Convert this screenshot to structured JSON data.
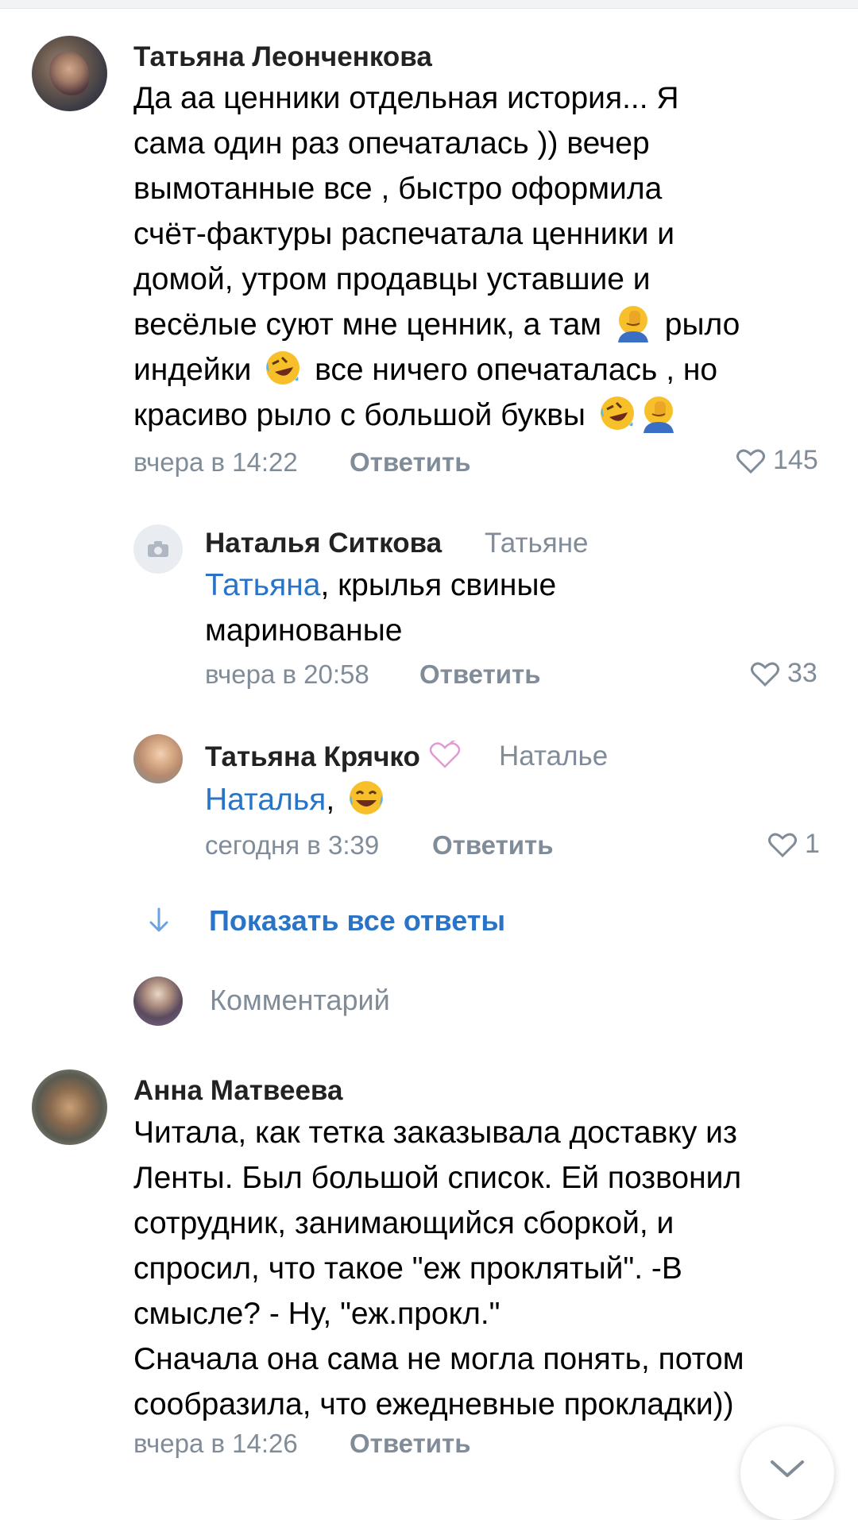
{
  "comments": [
    {
      "author": "Татьяна Леонченкова",
      "text_lines": [
        "Да аа ценники отдельная история... Я",
        "сама один раз опечаталась ))  вечер",
        "вымотанные все , быстро оформила",
        "счёт-фактуры распечатала ценники и",
        "домой, утром продавцы уставшие и"
      ],
      "text_line6a": "весёлые суют мне ценник, а там",
      "text_line6b": "рыло",
      "text_line7a": "индейки",
      "text_line7b": "все ничего опечаталась , но",
      "text_line8": "красиво рыло с большой буквы",
      "time": "вчера в 14:22",
      "reply_label": "Ответить",
      "likes": "145"
    },
    {
      "author": "Анна Матвеева",
      "text_lines": [
        "Читала, как тетка заказывала доставку из",
        "Ленты. Был большой список. Ей позвонил",
        "сотрудник, занимающийся сборкой, и",
        "спросил, что такое \"еж проклятый\". -В",
        "смысле? - Ну, \"еж.прокл.\"",
        "Сначала она сама не могла понять, потом",
        "сообразила, что ежедневные прокладки))"
      ],
      "time": "вчера в 14:26",
      "reply_label": "Ответить"
    }
  ],
  "replies": [
    {
      "author": "Наталья Ситкова",
      "addressee": "Татьяне",
      "mention": "Татьяна",
      "text_rest": ", крылья свиные",
      "text_line2": "маринованые",
      "time": "вчера в 20:58",
      "reply_label": "Ответить",
      "likes": "33"
    },
    {
      "author": "Татьяна Крячко",
      "addressee": "Наталье",
      "mention": "Наталья",
      "text_rest": ",",
      "time": "сегодня в 3:39",
      "reply_label": "Ответить",
      "likes": "1"
    }
  ],
  "show_all_replies": "Показать все ответы",
  "comment_placeholder": "Комментарий",
  "icons": {
    "heart": "heart-icon",
    "camera": "camera-icon",
    "arrow_down": "arrow-down-icon",
    "chevron": "chevron-down-icon",
    "facepalm": "facepalm-emoji",
    "rofl": "rolling-laughing-emoji",
    "joy": "tears-of-joy-emoji",
    "heart_decor": "heart-outline-emoji"
  },
  "colors": {
    "link": "#2a74c8",
    "secondary": "#818c99",
    "emoji": "#f7c02b"
  }
}
